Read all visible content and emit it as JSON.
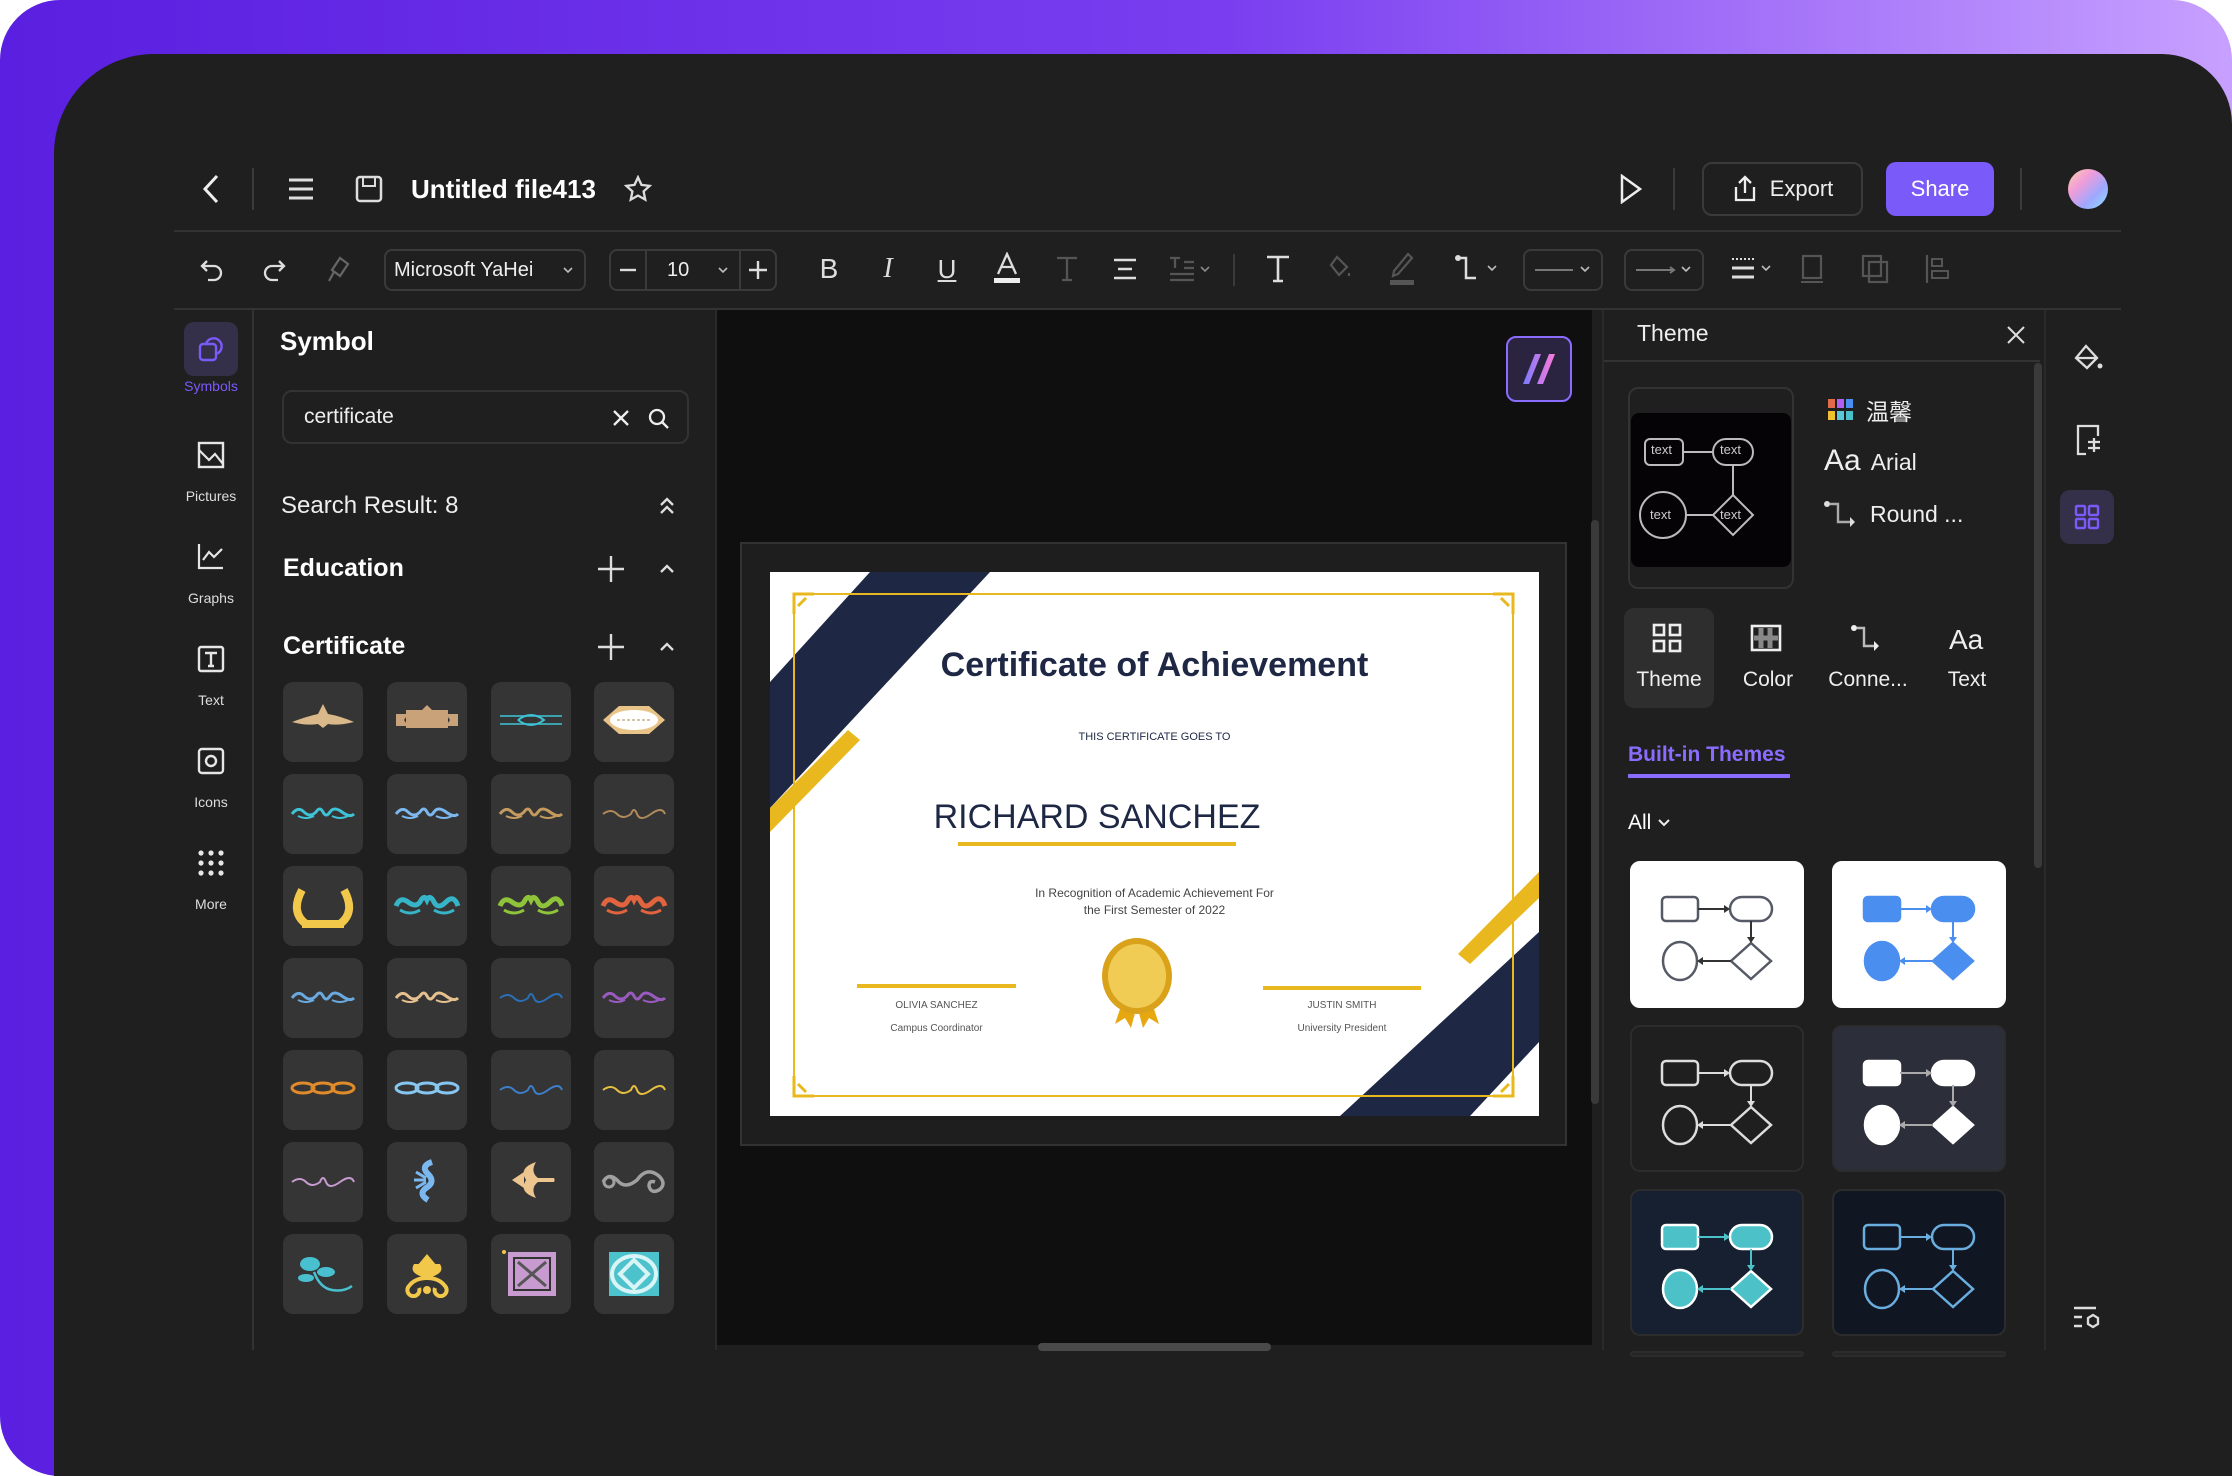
{
  "header": {
    "file_title": "Untitled file413",
    "export_label": "Export",
    "share_label": "Share",
    "accent": "#7a5af8"
  },
  "toolbar": {
    "font_family": "Microsoft YaHei",
    "font_size": "10"
  },
  "rail": {
    "items": [
      {
        "label": "Symbols",
        "icon": "symbols-icon",
        "active": true
      },
      {
        "label": "Pictures",
        "icon": "picture-icon"
      },
      {
        "label": "Graphs",
        "icon": "graph-icon"
      },
      {
        "label": "Text",
        "icon": "text-icon"
      },
      {
        "label": "Icons",
        "icon": "icons-icon"
      },
      {
        "label": "More",
        "icon": "more-grid-icon"
      }
    ]
  },
  "symbol_panel": {
    "title": "Symbol",
    "search_value": "certificate",
    "search_result": "Search Result: 8",
    "sections": [
      {
        "label": "Education"
      },
      {
        "label": "Certificate"
      }
    ],
    "tiles": [
      {
        "kind": "banner",
        "color": "#d9b98a"
      },
      {
        "kind": "ribbon",
        "color": "#c9a27a"
      },
      {
        "kind": "divider",
        "color": "#3ec3d6"
      },
      {
        "kind": "badge",
        "color": "#e9c489"
      },
      {
        "kind": "flourish",
        "color": "#3ec3d6"
      },
      {
        "kind": "flourish",
        "color": "#7cb8f0"
      },
      {
        "kind": "flourish",
        "color": "#c49a5e"
      },
      {
        "kind": "flourish-thin",
        "color": "#b08a5a"
      },
      {
        "kind": "wreath",
        "color": "#f2c84b"
      },
      {
        "kind": "flourish-bold",
        "color": "#36b5c8"
      },
      {
        "kind": "flourish-bold",
        "color": "#8fc43a"
      },
      {
        "kind": "flourish-bold",
        "color": "#e2643f"
      },
      {
        "kind": "flourish",
        "color": "#6aa9e0"
      },
      {
        "kind": "flourish",
        "color": "#e6c08f"
      },
      {
        "kind": "flourish-thin",
        "color": "#2a6fb8"
      },
      {
        "kind": "flourish",
        "color": "#9a5bc0"
      },
      {
        "kind": "chain",
        "color": "#e08a2a"
      },
      {
        "kind": "chain",
        "color": "#86c6f0"
      },
      {
        "kind": "flourish-thin",
        "color": "#3c7fc8"
      },
      {
        "kind": "flourish-thin",
        "color": "#e8c040"
      },
      {
        "kind": "flourish-thin",
        "color": "#c79bd0"
      },
      {
        "kind": "scroll",
        "color": "#7cb8f0"
      },
      {
        "kind": "fleur",
        "color": "#edc68f"
      },
      {
        "kind": "swirl",
        "color": "#a0a0a0"
      },
      {
        "kind": "leaf",
        "color": "#48c0d0"
      },
      {
        "kind": "lotus",
        "color": "#f2c84b"
      },
      {
        "kind": "square-tile",
        "color": "#c79bd0"
      },
      {
        "kind": "diamond-tile",
        "color": "#4cc2cc"
      }
    ]
  },
  "certificate": {
    "title": "Certificate of Achievement",
    "goes_to": "THIS CERTIFICATE GOES TO",
    "recipient": "RICHARD SANCHEZ",
    "recognition_line1": "In Recognition of Academic Achievement For",
    "recognition_line2": "the First Semester of 2022",
    "signer_left_name": "OLIVIA SANCHEZ",
    "signer_left_role": "Campus Coordinator",
    "signer_right_name": "JUSTIN SMITH",
    "signer_right_role": "University President",
    "navy": "#1e2744",
    "gold": "#e8b81e"
  },
  "theme_panel": {
    "title": "Theme",
    "preview_node_text": "text",
    "color_scheme_name": "温馨",
    "font_prefix": "Aa",
    "font_name": "Arial",
    "connector_name": "Round ...",
    "tabs": [
      {
        "label": "Theme",
        "icon": "theme-grid-icon",
        "active": true
      },
      {
        "label": "Color",
        "icon": "color-grid-icon"
      },
      {
        "label": "Conne...",
        "icon": "connector-icon"
      },
      {
        "label": "Text",
        "icon": "text-aa-icon"
      }
    ],
    "builtin_label": "Built-in Themes",
    "filter_label": "All",
    "themes": [
      {
        "bg": "#ffffff",
        "stroke": "#555a66",
        "fill": "none",
        "arrow": "#333333"
      },
      {
        "bg": "#ffffff",
        "stroke": "#4a8ef0",
        "fill": "#4a8ef0",
        "arrow": "#4a8ef0"
      },
      {
        "bg": "#1f1f1f",
        "stroke": "#dddddd",
        "fill": "none",
        "arrow": "#dddddd"
      },
      {
        "bg": "#2c2f3a",
        "stroke": "#ffffff",
        "fill": "#ffffff",
        "arrow": "#aaaaaa"
      },
      {
        "bg": "#172030",
        "stroke": "#ffffff",
        "fill": "#4cc2c8",
        "arrow": "#4cc2c8"
      },
      {
        "bg": "#111722",
        "stroke": "#6aaee0",
        "fill": "none",
        "arrow": "#6aaee0"
      }
    ]
  }
}
